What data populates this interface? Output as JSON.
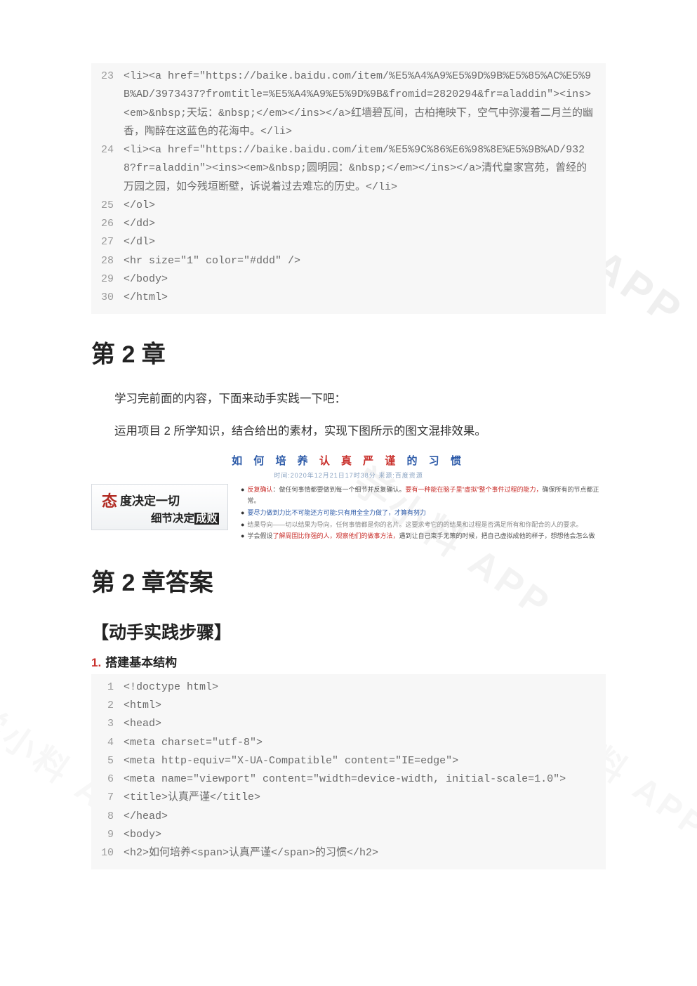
{
  "code_top": [
    {
      "n": "23",
      "text": "                <li><a href=\"https://baike.baidu.com/item/%E5%A4%A9%E5%9D%9B%E5%85%AC%E5%9B%AD/3973437?fromtitle=%E5%A4%A9%E5%9D%9B&fromid=2820294&fr=aladdin\"><ins><em>&nbsp;天坛：&nbsp;</em></ins></a>红墙碧瓦间，古柏掩映下，空气中弥漫着二月兰的幽香，陶醉在这蓝色的花海中。</li>"
    },
    {
      "n": "24",
      "text": "                <li><a href=\"https://baike.baidu.com/item/%E5%9C%86%E6%98%8E%E5%9B%AD/9328?fr=aladdin\"><ins><em>&nbsp;圆明园：&nbsp;</em></ins></a>清代皇家宫苑，曾经的万园之园，如今残垣断壁，诉说着过去难忘的历史。</li>"
    },
    {
      "n": "25",
      "text": "            </ol>"
    },
    {
      "n": "26",
      "text": "        </dd>"
    },
    {
      "n": "27",
      "text": "    </dl>"
    },
    {
      "n": "28",
      "text": "    <hr size=\"1\" color=\"#ddd\" />"
    },
    {
      "n": "29",
      "text": "</body>"
    },
    {
      "n": "30",
      "text": "</html>"
    }
  ],
  "chapter2_title": "第 2 章",
  "intro_line1": "学习完前面的内容，下面来动手实践一下吧：",
  "intro_line2": "运用项目 2 所学知识，结合给出的素材，实现下图所示的图文混排效果。",
  "mock": {
    "title_a": "如 何 培 养",
    "title_b": "认 真 严 谨",
    "title_c": "的 习 惯",
    "subtitle": "时间:2020年12月21日17时38分    来源:百度资源",
    "left_line1": "度决定一切",
    "left_line2_a": "细节决定",
    "left_line2_b": "成败",
    "bullets": [
      {
        "pre": "反复确认",
        "body": "：做任何事情都要做到每一个细节并反复确认。",
        "red": "要有一种能在脑子里“虚拟”整个事件过程的能力，",
        "tail": "确保所有的节点都正常。"
      },
      {
        "pre": "",
        "body": "要尽力做到力比不可能还方可能:只有用全全力做了，才算有努力",
        "class": "blue"
      },
      {
        "pre": "",
        "body": "结果导向——切以结果为导向，任何事情都是你的名片。这要求考它的的结果和过程是否满足所有和你配合的人的要求。",
        "class": "grey"
      },
      {
        "pre": "",
        "body": "学会假设",
        "red": "了解周围比你强的人，观察他们的做事方法，",
        "tail": "遇到让自己束手无策的时候，把自己虚拟成他的样子，想想他会怎么做"
      }
    ]
  },
  "answer_title": "第 2 章答案",
  "section_title": "【动手实践步骤】",
  "step1_num": "1.",
  "step1_title": "搭建基本结构",
  "code_bottom": [
    {
      "n": "1",
      "text": "<!doctype html>"
    },
    {
      "n": "2",
      "text": "<html>"
    },
    {
      "n": "3",
      "text": "<head>"
    },
    {
      "n": "4",
      "text": "<meta charset=\"utf-8\">"
    },
    {
      "n": "5",
      "text": "<meta http-equiv=\"X-UA-Compatible\" content=\"IE=edge\">"
    },
    {
      "n": "6",
      "text": "<meta name=\"viewport\" content=\"width=device-width, initial-scale=1.0\">"
    },
    {
      "n": "7",
      "text": "<title>认真严谨</title>"
    },
    {
      "n": "8",
      "text": "</head>"
    },
    {
      "n": "9",
      "text": "<body>"
    },
    {
      "n": "10",
      "text": "<h2>如何培养<span>认真严谨</span>的习惯</h2>"
    }
  ],
  "watermark": "学小料 APP"
}
